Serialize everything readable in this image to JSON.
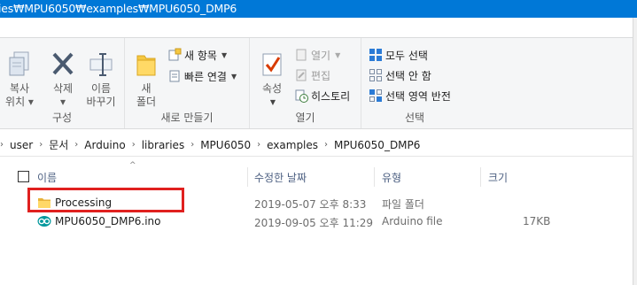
{
  "window": {
    "title": "ies₩MPU6050₩examples₩MPU6050_DMP6"
  },
  "ribbon": {
    "organize": {
      "label": "구성",
      "copy_line1": "복사",
      "copy_line2": "위치 ▾",
      "delete_line1": "삭제",
      "delete_line2": "▾",
      "rename_line1": "이름",
      "rename_line2": "바꾸기"
    },
    "new": {
      "label": "새로 만들기",
      "new_folder_line1": "새",
      "new_folder_line2": "폴더",
      "new_item": "새 항목",
      "easy_access": "빠른 연결"
    },
    "open": {
      "label": "열기",
      "properties": "속성",
      "open": "열기",
      "edit": "편집",
      "history": "히스토리"
    },
    "select": {
      "label": "선택",
      "select_all": "모두 선택",
      "select_none": "선택 안 함",
      "invert": "선택 영역 반전"
    }
  },
  "breadcrumb": [
    "user",
    "문서",
    "Arduino",
    "libraries",
    "MPU6050",
    "examples",
    "MPU6050_DMP6"
  ],
  "columns": {
    "name": "이름",
    "date": "수정한 날짜",
    "type": "유형",
    "size": "크기"
  },
  "files": [
    {
      "name": "Processing",
      "date": "2019-05-07 오후 8:33",
      "type": "파일 폴더",
      "size": "",
      "icon": "folder-icon"
    },
    {
      "name": "MPU6050_DMP6.ino",
      "date": "2019-09-05 오후 11:29",
      "type": "Arduino file",
      "size": "17KB",
      "icon": "arduino-icon"
    }
  ],
  "colors": {
    "titlebar": "#0078d7",
    "highlight": "#e0201f",
    "accent": "#2b7bd6"
  }
}
